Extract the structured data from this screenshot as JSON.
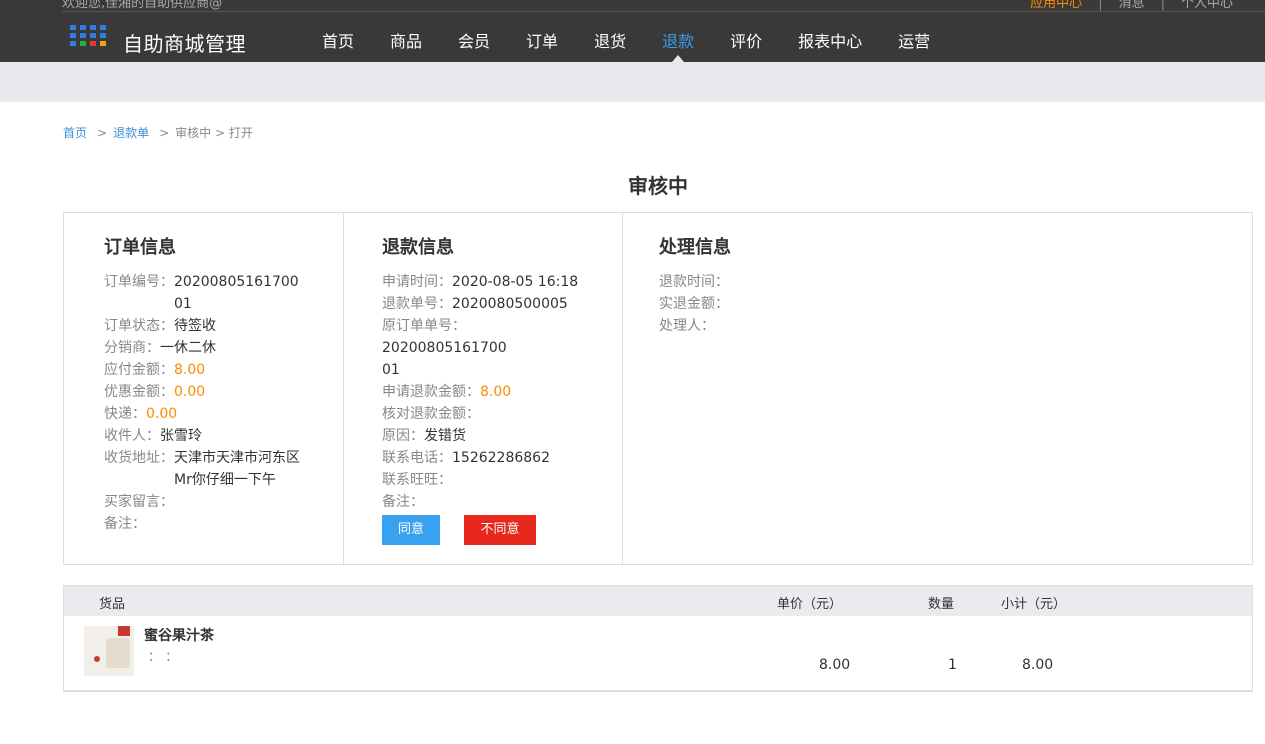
{
  "header": {
    "welcome": "欢迎您,佳湘的自助供应商@",
    "links": [
      "应用中心",
      "消息",
      "个人中心"
    ],
    "brand": "自助商城管理",
    "nav": [
      "首页",
      "商品",
      "会员",
      "订单",
      "退货",
      "退款",
      "评价",
      "报表中心",
      "运营"
    ],
    "active_nav": "退款"
  },
  "breadcrumb": {
    "home": "首页",
    "refund_list": "退款单",
    "current": "审核中 > 打开",
    "sep": ">"
  },
  "title": "审核中",
  "order_info": {
    "heading": "订单信息",
    "order_no_label": "订单编号：",
    "order_no": "2020080516170001",
    "status_label": "订单状态：",
    "status": "待签收",
    "distributor_label": "分销商：",
    "distributor": "一休二休",
    "payable_label": "应付金额：",
    "payable": "8.00",
    "discount_label": "优惠金额：",
    "discount": "0.00",
    "shipping_label": "快递：",
    "shipping": "0.00",
    "receiver_label": "收件人：",
    "receiver": "张雪玲",
    "address_label": "收货地址：",
    "address": "天津市天津市河东区Mr你仔细一下午",
    "buyer_msg_label": "买家留言：",
    "remark_label": "备注："
  },
  "refund_info": {
    "heading": "退款信息",
    "apply_time_label": "申请时间：",
    "apply_time": "2020-08-05 16:18",
    "refund_no_label": "退款单号：",
    "refund_no": "2020080500005",
    "orig_order_label": "原订单单号：",
    "orig_order": "2020080516170001",
    "apply_amount_label": "申请退款金额：",
    "apply_amount": "8.00",
    "check_amount_label": "核对退款金额：",
    "reason_label": "原因：",
    "reason": "发错货",
    "phone_label": "联系电话：",
    "phone": "15262286862",
    "wangwang_label": "联系旺旺：",
    "remark_label": "备注：",
    "agree": "同意",
    "disagree": "不同意"
  },
  "process_info": {
    "heading": "处理信息",
    "refund_time_label": "退款时间：",
    "actual_amount_label": "实退金额：",
    "handler_label": "处理人："
  },
  "goods": {
    "headers": {
      "goods": "货品",
      "price": "单价（元）",
      "qty": "数量",
      "subtotal": "小计（元）"
    },
    "items": [
      {
        "name": "蜜谷果汁茶",
        "spec": "：  ：",
        "price": "8.00",
        "qty": "1",
        "subtotal": "8.00"
      }
    ]
  },
  "colors": {
    "accent": "#3d9ae8",
    "orange": "#ff8a00",
    "danger": "#e6291c",
    "topbar": "#393939"
  }
}
